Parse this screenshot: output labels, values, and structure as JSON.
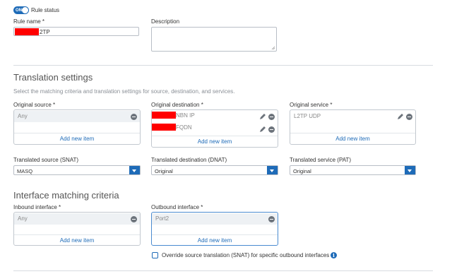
{
  "rule_status": {
    "toggle_text": "ON",
    "label": "Rule status"
  },
  "rule_name": {
    "label": "Rule name *",
    "value_suffix": "2TP"
  },
  "description": {
    "label": "Description",
    "value": ""
  },
  "translation": {
    "title": "Translation settings",
    "subtitle": "Select the matching criteria and translation settings for source, destination, and services.",
    "original_source": {
      "label": "Original source *",
      "items": [
        "Any"
      ],
      "add_label": "Add new item"
    },
    "original_destination": {
      "label": "Original destination *",
      "items": [
        "NBN IP",
        "FQDN"
      ],
      "add_label": "Add new item"
    },
    "original_service": {
      "label": "Original service *",
      "items": [
        "L2TP UDP"
      ],
      "add_label": "Add new item"
    },
    "translated_source": {
      "label": "Translated source (SNAT)",
      "value": "MASQ"
    },
    "translated_destination": {
      "label": "Translated destination (DNAT)",
      "value": "Original"
    },
    "translated_service": {
      "label": "Translated service (PAT)",
      "value": "Original"
    }
  },
  "interface": {
    "title": "Interface matching criteria",
    "inbound": {
      "label": "Inbound interface *",
      "items": [
        "Any"
      ],
      "add_label": "Add new item"
    },
    "outbound": {
      "label": "Outbound interface *",
      "items": [
        "Port2"
      ],
      "add_label": "Add new item"
    },
    "override_label": "Override source translation (SNAT) for specific outbound interfaces",
    "info_glyph": "i"
  },
  "colors": {
    "accent": "#1e6bb8",
    "redaction": "#ff0000"
  }
}
